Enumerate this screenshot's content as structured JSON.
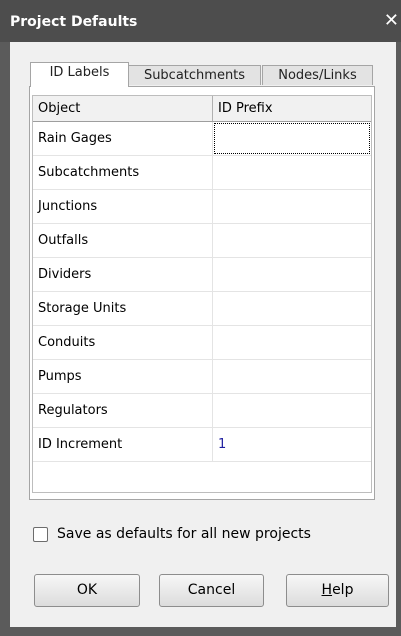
{
  "window": {
    "title": "Project Defaults",
    "close_glyph": "✕"
  },
  "tabs": [
    {
      "label": "ID Labels",
      "active": true
    },
    {
      "label": "Subcatchments",
      "active": false
    },
    {
      "label": "Nodes/Links",
      "active": false
    }
  ],
  "grid": {
    "columns": [
      "Object",
      "ID Prefix"
    ],
    "rows": [
      {
        "object": "Rain Gages",
        "value": ""
      },
      {
        "object": "Subcatchments",
        "value": ""
      },
      {
        "object": "Junctions",
        "value": ""
      },
      {
        "object": "Outfalls",
        "value": ""
      },
      {
        "object": "Dividers",
        "value": ""
      },
      {
        "object": "Storage Units",
        "value": ""
      },
      {
        "object": "Conduits",
        "value": ""
      },
      {
        "object": "Pumps",
        "value": ""
      },
      {
        "object": "Regulators",
        "value": ""
      },
      {
        "object": "ID Increment",
        "value": "1"
      }
    ]
  },
  "save_defaults": {
    "label": "Save as defaults for all new projects",
    "checked": false
  },
  "buttons": {
    "ok": "OK",
    "cancel": "Cancel",
    "help_first": "H",
    "help_rest": "elp"
  },
  "colors": {
    "titlebar": "#4d4d4d",
    "client": "#f0f0f0",
    "value_text": "#1f1fa0"
  },
  "icons": {
    "close": "close-icon",
    "checkbox": "checkbox-unchecked"
  }
}
